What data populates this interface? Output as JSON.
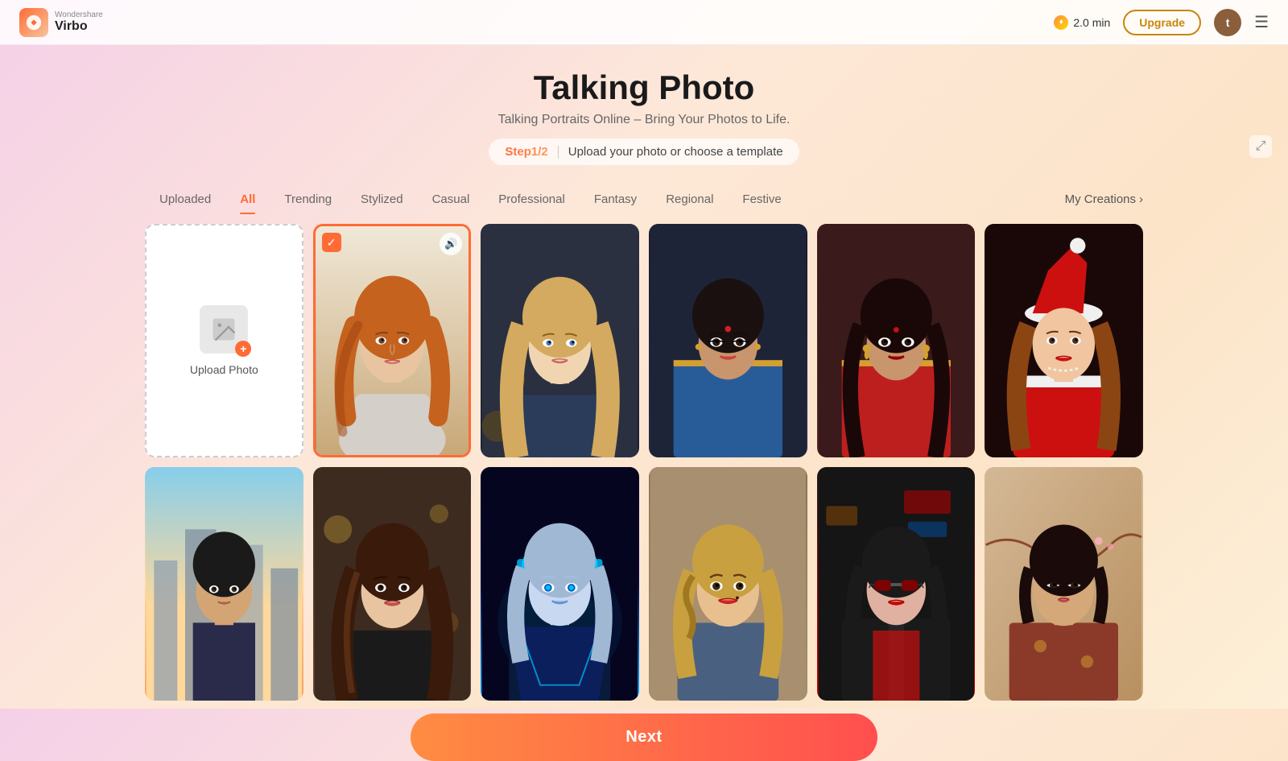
{
  "app": {
    "logo_brand": "Wondershare",
    "logo_name": "Virbo",
    "credits": "2.0 min",
    "upgrade_label": "Upgrade",
    "avatar_initial": "t",
    "page_title": "Talking Photo",
    "page_subtitle": "Talking Portraits Online – Bring Your Photos to Life.",
    "step_text": "Step1/2",
    "step_desc": "Upload your photo or choose a template"
  },
  "tabs": [
    {
      "id": "uploaded",
      "label": "Uploaded",
      "active": false
    },
    {
      "id": "all",
      "label": "All",
      "active": true
    },
    {
      "id": "trending",
      "label": "Trending",
      "active": false
    },
    {
      "id": "stylized",
      "label": "Stylized",
      "active": false
    },
    {
      "id": "casual",
      "label": "Casual",
      "active": false
    },
    {
      "id": "professional",
      "label": "Professional",
      "active": false
    },
    {
      "id": "fantasy",
      "label": "Fantasy",
      "active": false
    },
    {
      "id": "regional",
      "label": "Regional",
      "active": false
    },
    {
      "id": "festive",
      "label": "Festive",
      "active": false
    }
  ],
  "my_creations_label": "My Creations",
  "upload_card": {
    "label": "Upload Photo"
  },
  "next_label": "Next",
  "photos": [
    {
      "id": 1,
      "selected": true,
      "bg": "bg-redhead",
      "face_color": "#e8c5a0",
      "hair_color": "#c4621e"
    },
    {
      "id": 2,
      "selected": false,
      "bg": "bg-blonde",
      "face_color": "#f0d5b0",
      "hair_color": "#d4aa70"
    },
    {
      "id": 3,
      "selected": false,
      "bg": "bg-blue-saree",
      "face_color": "#c8956c",
      "hair_color": "#1a1a1a"
    },
    {
      "id": 4,
      "selected": false,
      "bg": "bg-red-saree",
      "face_color": "#c8956c",
      "hair_color": "#2a1a1a"
    },
    {
      "id": 5,
      "selected": false,
      "bg": "bg-christmas",
      "face_color": "#f0c5a0",
      "hair_color": "#8b4513"
    },
    {
      "id": 6,
      "selected": false,
      "bg": "bg-city",
      "face_color": "#d4a574",
      "hair_color": "#1a1a1a"
    },
    {
      "id": 7,
      "selected": false,
      "bg": "bg-brunette",
      "face_color": "#e8c5a0",
      "hair_color": "#6b3a2a"
    },
    {
      "id": 8,
      "selected": false,
      "bg": "bg-cyber",
      "face_color": "#c8d8f0",
      "hair_color": "#a0b8d4"
    },
    {
      "id": 9,
      "selected": false,
      "bg": "bg-vintage",
      "face_color": "#e8c090",
      "hair_color": "#c8a040"
    },
    {
      "id": 10,
      "selected": false,
      "bg": "bg-punk",
      "face_color": "#e0b0a0",
      "hair_color": "#1a1a1a"
    },
    {
      "id": 11,
      "selected": false,
      "bg": "bg-asian",
      "face_color": "#d4a878",
      "hair_color": "#2a1a1a"
    }
  ]
}
